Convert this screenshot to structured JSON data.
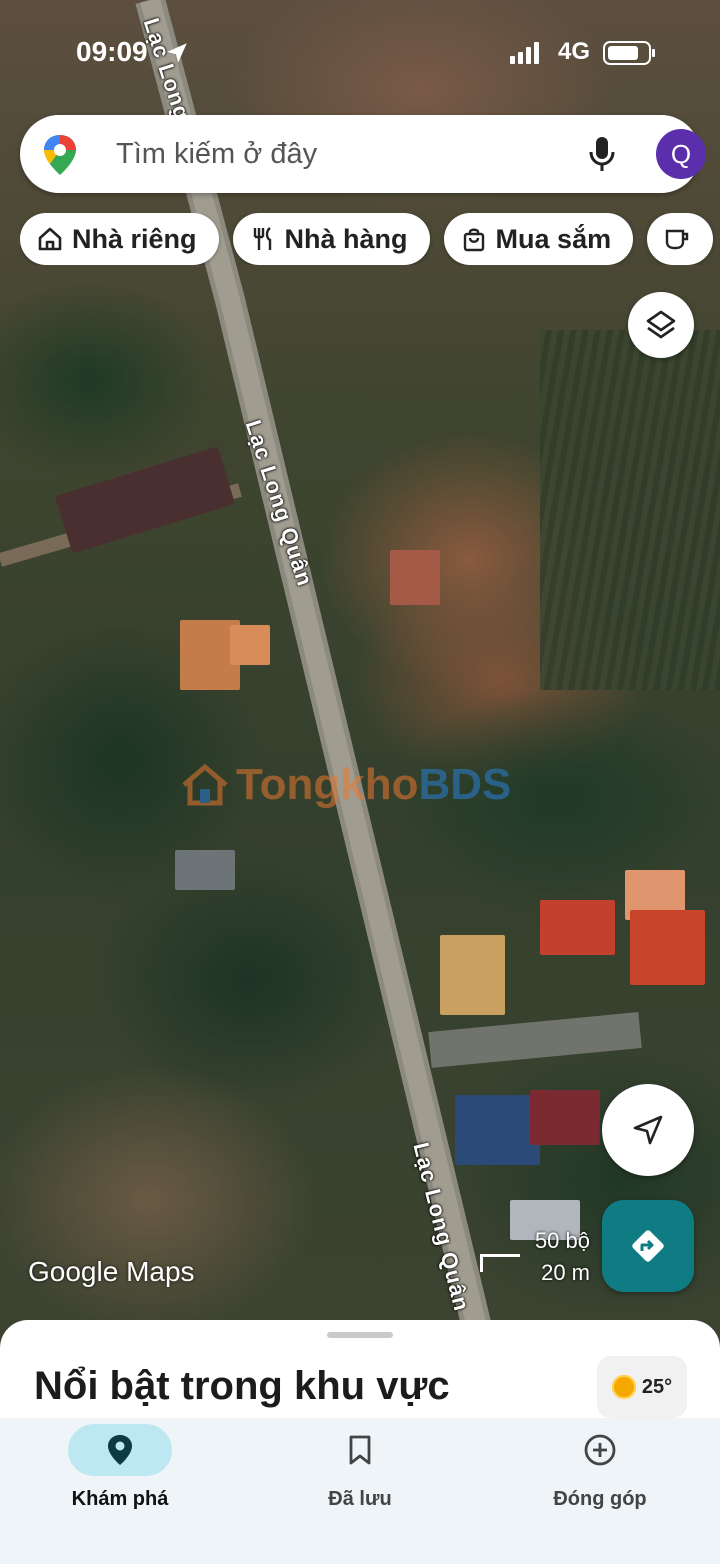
{
  "status_bar": {
    "time": "09:09",
    "network": "4G",
    "battery_level": 0.8
  },
  "search": {
    "placeholder": "Tìm kiếm ở đây",
    "avatar_letter": "Q"
  },
  "chips": [
    {
      "label": "Nhà riêng",
      "icon": "home-icon"
    },
    {
      "label": "Nhà hàng",
      "icon": "restaurant-icon"
    },
    {
      "label": "Mua sắm",
      "icon": "shopping-bag-icon"
    },
    {
      "label": "",
      "icon": "coffee-icon"
    }
  ],
  "map": {
    "street_name": "Lạc Long Quân",
    "street_name_partial": "Lạc Long",
    "watermark": {
      "part1": "Tongkho",
      "part2": "BDS"
    },
    "attribution": "Google Maps",
    "scale": {
      "imperial": "50 bộ",
      "metric": "20 m"
    }
  },
  "sheet": {
    "title": "Nổi bật trong khu vực",
    "weather": "25°"
  },
  "nav": [
    {
      "label": "Khám phá",
      "icon": "explore-pin-icon",
      "active": true
    },
    {
      "label": "Đã lưu",
      "icon": "bookmark-icon",
      "active": false
    },
    {
      "label": "Đóng góp",
      "icon": "add-circle-icon",
      "active": false
    }
  ],
  "colors": {
    "accent": "#0f7c84",
    "avatar": "#5b2eab",
    "nav_active": "#bde8f2"
  }
}
